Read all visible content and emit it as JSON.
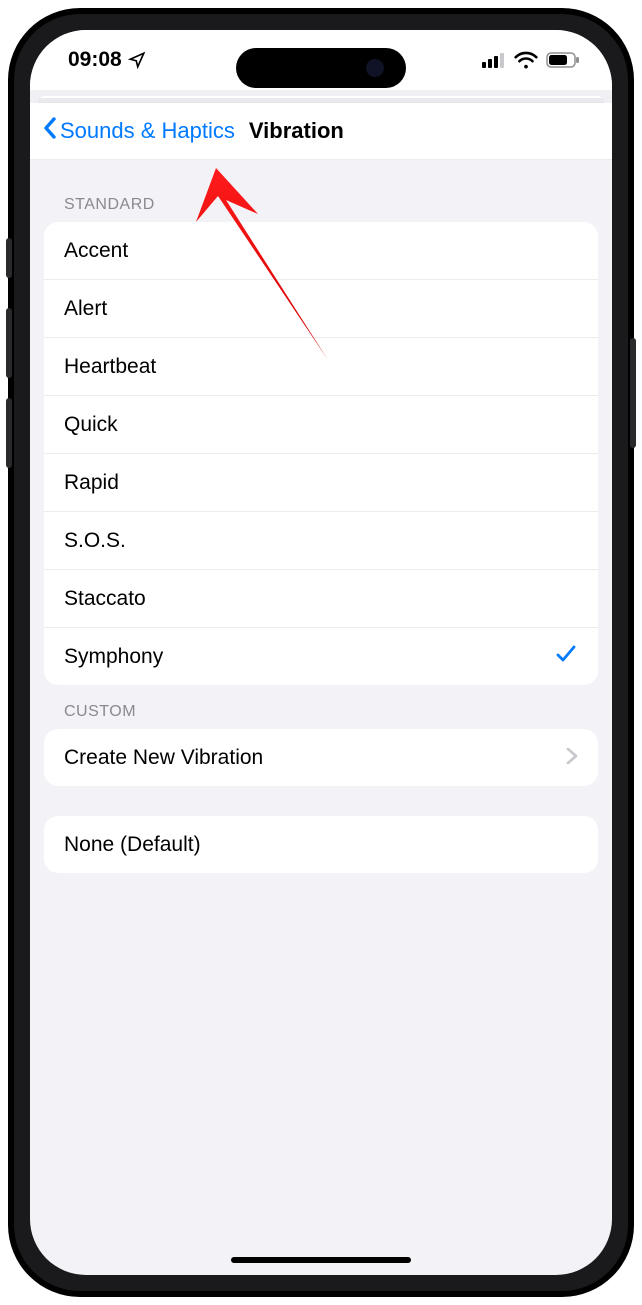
{
  "status": {
    "time": "09:08"
  },
  "nav": {
    "back_label": "Sounds & Haptics",
    "title": "Vibration"
  },
  "sections": {
    "standard": {
      "header": "STANDARD",
      "items": [
        {
          "label": "Accent",
          "selected": false
        },
        {
          "label": "Alert",
          "selected": false
        },
        {
          "label": "Heartbeat",
          "selected": false
        },
        {
          "label": "Quick",
          "selected": false
        },
        {
          "label": "Rapid",
          "selected": false
        },
        {
          "label": "S.O.S.",
          "selected": false
        },
        {
          "label": "Staccato",
          "selected": false
        },
        {
          "label": "Symphony",
          "selected": true
        }
      ]
    },
    "custom": {
      "header": "CUSTOM",
      "create_label": "Create New Vibration"
    },
    "none_label": "None (Default)"
  }
}
